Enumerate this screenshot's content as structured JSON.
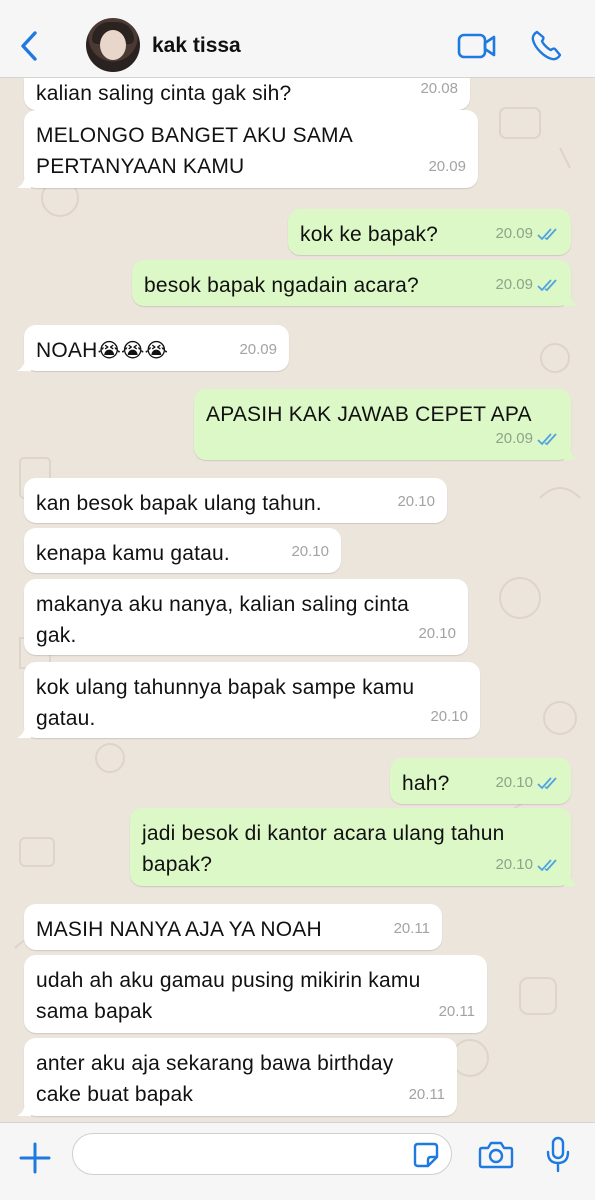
{
  "header": {
    "contact_name": "kak tissa",
    "icons": {
      "back": "chevron-left-icon",
      "video": "video-camera-icon",
      "call": "phone-icon",
      "avatar": "profile-photo"
    }
  },
  "colors": {
    "accent": "#1f7ae0",
    "incoming_bubble": "#ffffff",
    "outgoing_bubble": "#dcf8c6",
    "chat_background": "#ece5dc",
    "read_ticks": "#4fa3e0"
  },
  "messages": [
    {
      "direction": "in",
      "text": "kalian saling cinta gak sih?",
      "time": "20.08"
    },
    {
      "direction": "in",
      "text": "MELONGO BANGET AKU SAMA\nPERTANYAAN KAMU",
      "time": "20.09"
    },
    {
      "direction": "out",
      "text": "kok ke bapak?",
      "time": "20.09",
      "status": "read"
    },
    {
      "direction": "out",
      "text": "besok bapak ngadain acara?",
      "time": "20.09",
      "status": "read"
    },
    {
      "direction": "in",
      "text": "NOAH",
      "emoji": "😭😭😭",
      "time": "20.09"
    },
    {
      "direction": "out",
      "text": "APASIH KAK JAWAB CEPET APA",
      "time": "20.09",
      "status": "read"
    },
    {
      "direction": "in",
      "text": "kan besok bapak ulang tahun.",
      "time": "20.10"
    },
    {
      "direction": "in",
      "text": "kenapa kamu gatau.",
      "time": "20.10"
    },
    {
      "direction": "in",
      "text": "makanya aku nanya, kalian saling cinta\ngak.",
      "time": "20.10"
    },
    {
      "direction": "in",
      "text": "kok ulang tahunnya bapak sampe kamu\ngatau.",
      "time": "20.10"
    },
    {
      "direction": "out",
      "text": "hah?",
      "time": "20.10",
      "status": "read"
    },
    {
      "direction": "out",
      "text": "jadi besok di kantor acara ulang tahun\nbapak?",
      "time": "20.10",
      "status": "read"
    },
    {
      "direction": "in",
      "text": "MASIH NANYA AJA YA NOAH",
      "time": "20.11"
    },
    {
      "direction": "in",
      "text": "udah ah aku gamau pusing mikirin kamu\nsama bapak",
      "time": "20.11"
    },
    {
      "direction": "in",
      "text": "anter aku aja sekarang bawa birthday\ncake buat bapak",
      "time": "20.11"
    }
  ],
  "input_bar": {
    "placeholder": "",
    "icons": {
      "plus": "plus-icon",
      "sticker": "sticker-icon",
      "camera": "camera-icon",
      "mic": "microphone-icon"
    }
  }
}
